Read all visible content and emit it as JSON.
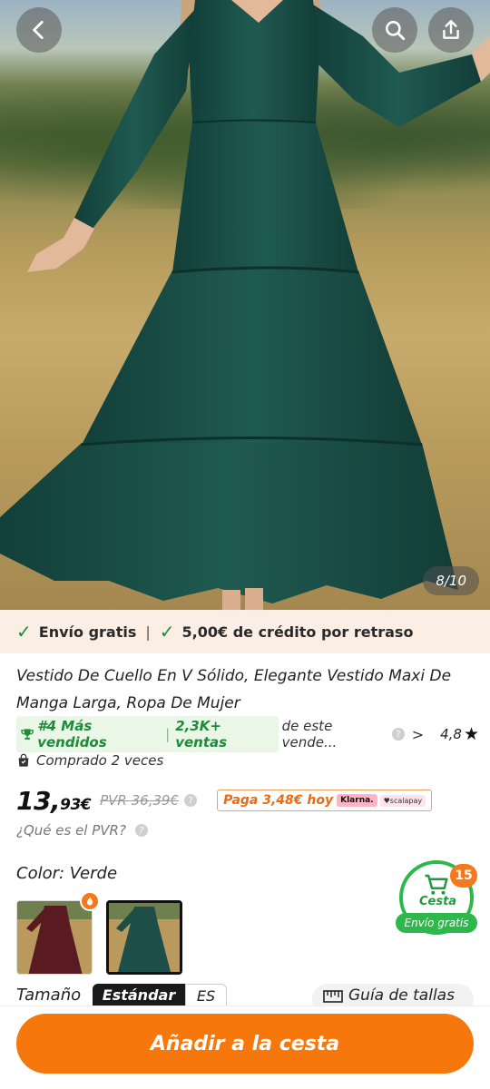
{
  "hero": {
    "image_counter": "8/10",
    "back_icon": "chevron-left-icon",
    "search_icon": "search-icon",
    "share_icon": "share-icon"
  },
  "shipping": {
    "free_shipping": "Envío gratis",
    "separator": "|",
    "delay_credit": "5,00€ de crédito por retraso",
    "check_color": "#1f8a3a"
  },
  "product": {
    "title": "Vestido De Cuello En V Sólido, Elegante Vestido Maxi De Manga Larga, Ropa De Mujer",
    "rank": "#4 Más vendidos",
    "rank_separator": "|",
    "sales": "2,3K+ ventas",
    "seller_text": "de este vende...",
    "rating": "4,8",
    "bought": "Comprado 2 veces"
  },
  "price": {
    "integer": "13,",
    "decimal": "93€",
    "pvr": "PVR 36,39€",
    "pay_today": "Paga 3,48€ hoy",
    "klarna": "Klarna.",
    "scalapay": "♥scalapay",
    "accent_color": "#ec6a12"
  },
  "pvr_question": "¿Qué es el PVR?",
  "color": {
    "label": "Color: Verde",
    "selected": "Verde"
  },
  "cart": {
    "badge": "15",
    "label": "Cesta",
    "free_shipping": "Envío gratis",
    "color": "#2db84b"
  },
  "size": {
    "label": "Tamaño",
    "standard": "Estándar",
    "region": "ES",
    "guide": "Guía de tallas"
  },
  "actions": {
    "add_to_cart": "Añadir a la cesta",
    "button_color": "#f6780c"
  }
}
